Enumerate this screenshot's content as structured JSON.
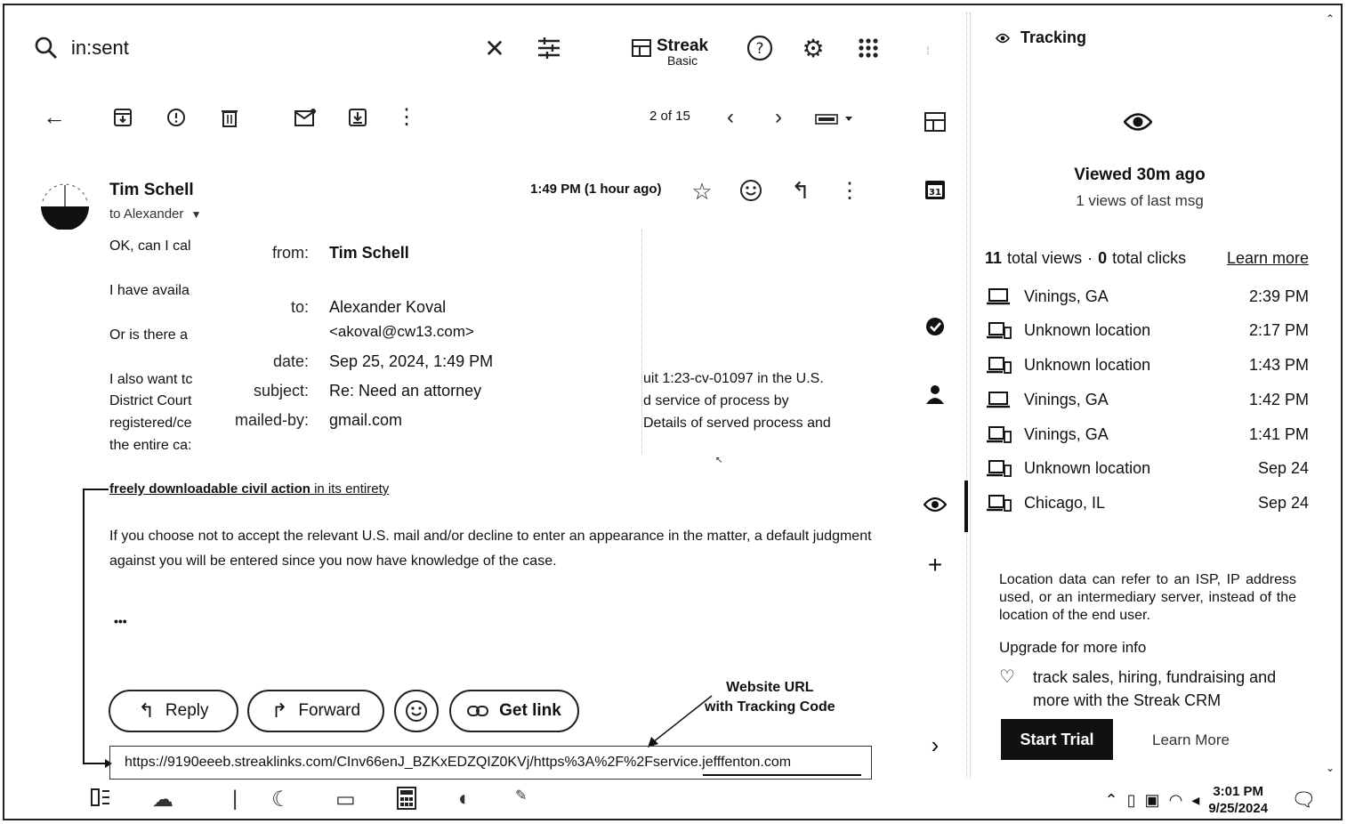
{
  "search": {
    "query": "in:sent"
  },
  "streak": {
    "name": "Streak",
    "plan": "Basic"
  },
  "pager": {
    "text": "2 of 15"
  },
  "email": {
    "sender": "Tim Schell",
    "to_line": "to Alexander",
    "time": "1:49 PM (1 hour ago)",
    "lines": [
      "OK, can I cal",
      "I have availa",
      "Or is there a",
      "I also want tc",
      "District Court",
      "registered/ce",
      "the entire ca:"
    ],
    "right_lines": [
      "uit 1:23-cv-01097 in the U.S.",
      "d service of process by",
      "Details of served process and"
    ],
    "link_text": "freely downloadable civil action",
    "link_suffix": " in its entirety",
    "paragraph": "If you choose not to accept the relevant U.S. mail and/or decline to enter an appearance in the matter, a default judgment against you will be entered since you now have knowledge of the case.",
    "ellipsis": "•••"
  },
  "details": {
    "from_label": "from:",
    "from_value": "Tim Schell",
    "to_label": "to:",
    "to_value_1": "Alexander Koval",
    "to_value_2": "<akoval@cw13.com>",
    "date_label": "date:",
    "date_value": "Sep 25, 2024, 1:49 PM",
    "subject_label": "subject:",
    "subject_value": "Re: Need an attorney",
    "mailedby_label": "mailed-by:",
    "mailedby_value": "gmail.com"
  },
  "actions": {
    "reply": "Reply",
    "forward": "Forward",
    "get_link": "Get link"
  },
  "url": "https://9190eeeb.streaklinks.com/CInv66enJ_BZKxEDZQIZ0KVj/https%3A%2F%2Fservice.jefffenton.com",
  "annotation": {
    "line1": "Website URL",
    "line2": "with Tracking Code"
  },
  "tracking": {
    "title": "Tracking",
    "viewed": "Viewed 30m ago",
    "views_last": "1 views of last msg",
    "total_views_num": "11",
    "total_views_label": "total views",
    "sep": "·",
    "total_clicks_num": "0",
    "total_clicks_label": "total clicks",
    "learn_more": "Learn more",
    "rows": [
      {
        "device": "laptop-icon",
        "place": "Vinings, GA",
        "when": "2:39 PM"
      },
      {
        "device": "devices-icon",
        "place": "Unknown location",
        "when": "2:17 PM"
      },
      {
        "device": "devices-icon",
        "place": "Unknown location",
        "when": "1:43 PM"
      },
      {
        "device": "laptop-icon",
        "place": "Vinings, GA",
        "when": "1:42 PM"
      },
      {
        "device": "devices-icon",
        "place": "Vinings, GA",
        "when": "1:41 PM"
      },
      {
        "device": "devices-icon",
        "place": "Unknown location",
        "when": "Sep 24"
      },
      {
        "device": "devices-icon",
        "place": "Chicago, IL",
        "when": "Sep 24"
      }
    ],
    "note": "Location data can refer to an ISP, IP address used, or an intermediary server, instead of the location of the end user.",
    "upgrade": "Upgrade for more info",
    "crm_line1": "track sales, hiring, fundraising and",
    "crm_line2": "more with the Streak CRM",
    "start_trial": "Start Trial",
    "learn_more_btn": "Learn More"
  },
  "taskbar": {
    "time": "3:01 PM",
    "date": "9/25/2024"
  }
}
